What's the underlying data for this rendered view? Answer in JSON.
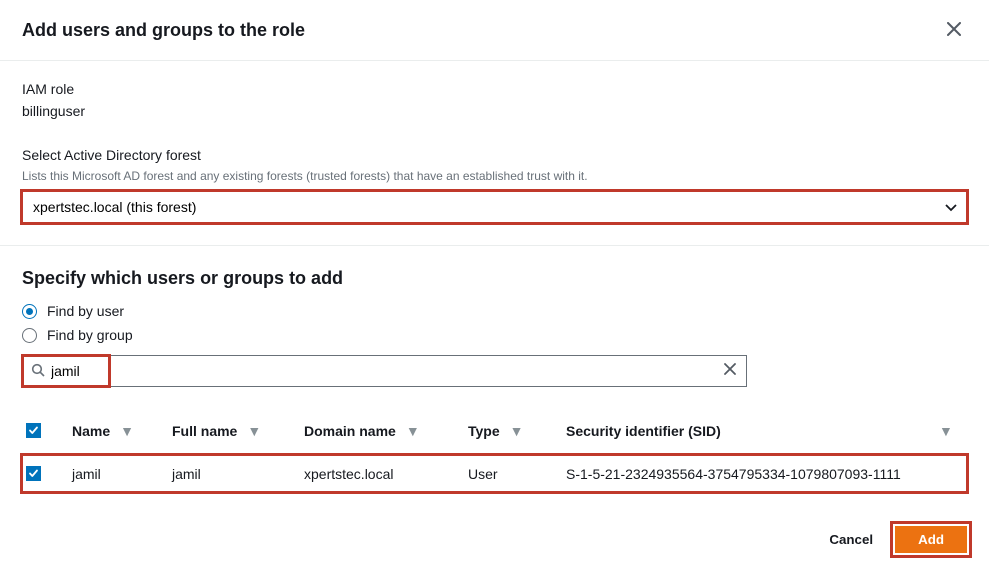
{
  "header": {
    "title": "Add users and groups to the role"
  },
  "iam": {
    "label": "IAM role",
    "value": "billinguser"
  },
  "forest": {
    "label": "Select Active Directory forest",
    "hint": "Lists this Microsoft AD forest and any existing forests (trusted forests) that have an established trust with it.",
    "selected": "xpertstec.local (this forest)"
  },
  "specify": {
    "title": "Specify which users or groups to add",
    "radios": {
      "by_user": "Find by user",
      "by_group": "Find by group"
    },
    "selected_radio": "by_user",
    "search": {
      "value": "jamil"
    }
  },
  "table": {
    "headers": {
      "name": "Name",
      "fullname": "Full name",
      "domain": "Domain name",
      "type": "Type",
      "sid": "Security identifier (SID)"
    },
    "rows": [
      {
        "checked": true,
        "name": "jamil",
        "fullname": "jamil",
        "domain": "xpertstec.local",
        "type": "User",
        "sid": "S-1-5-21-2324935564-3754795334-1079807093-1111"
      }
    ]
  },
  "footer": {
    "cancel": "Cancel",
    "add": "Add"
  }
}
